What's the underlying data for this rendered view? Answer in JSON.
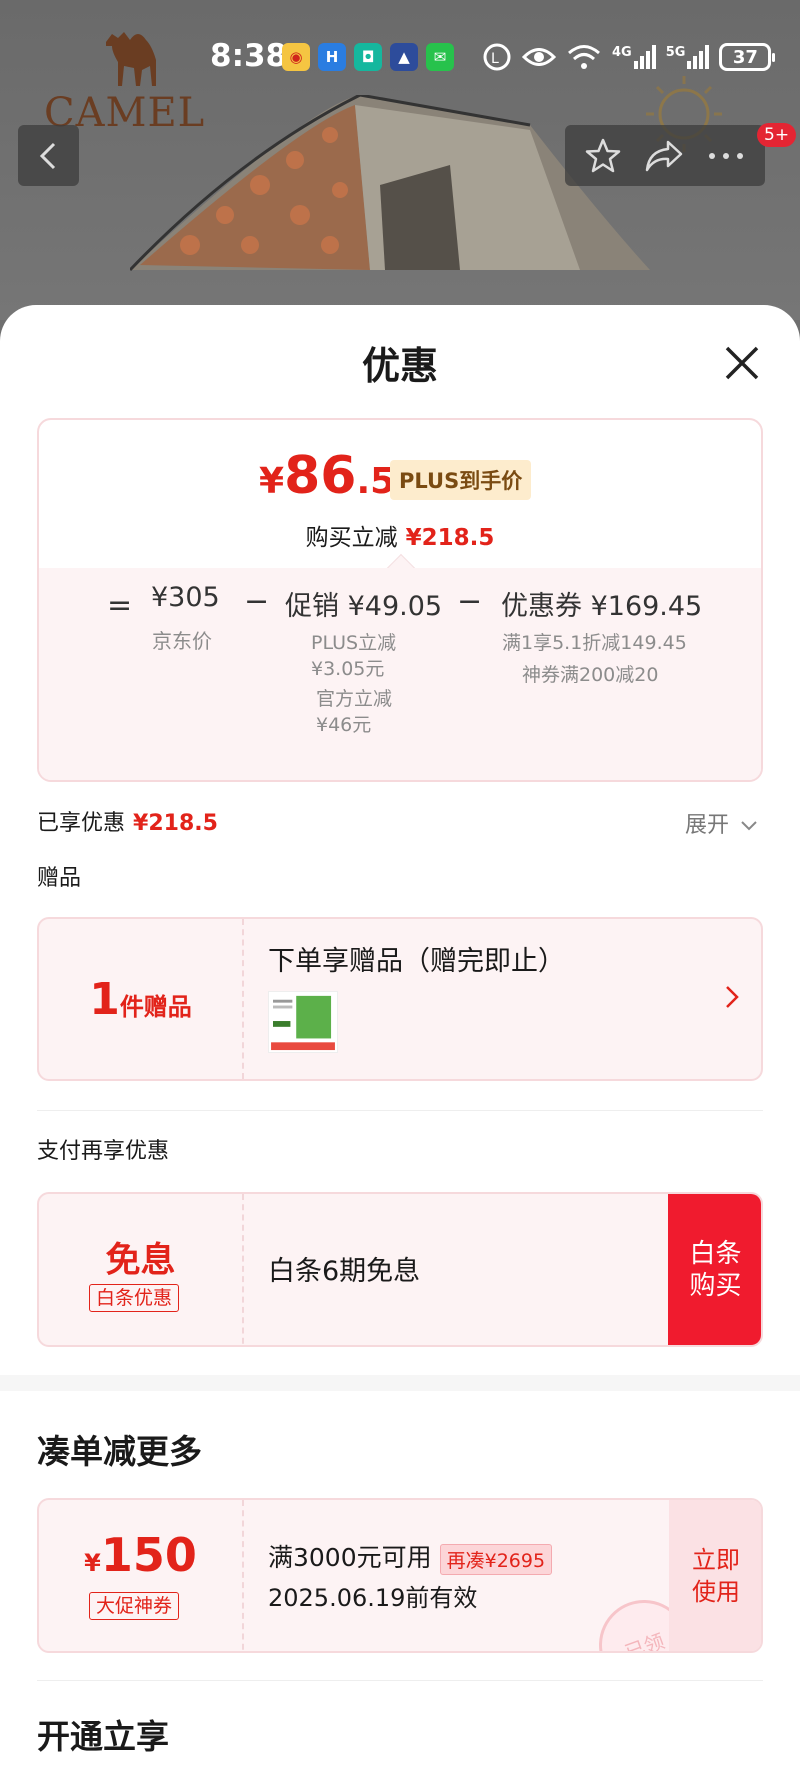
{
  "status_bar": {
    "time": "8:38",
    "network_4g": "4G",
    "network_5g": "5G",
    "battery": "37"
  },
  "background": {
    "brand": "CAMEL",
    "badge_count": "5+"
  },
  "sheet": {
    "title": "优惠",
    "price_card": {
      "final_price_yen": "¥",
      "final_price_int": "86",
      "final_price_dec": ".5",
      "plus_tag": "PLUS到手价",
      "reduce_label": "购买立减",
      "reduce_amount": "¥218.5",
      "eq": "=",
      "minus1": "−",
      "minus2": "−",
      "jd_price": "¥305",
      "jd_label": "京东价",
      "promo_amount": "促销 ¥49.05",
      "promo_sub1": "PLUS立减",
      "promo_sub1_val": "¥3.05元",
      "promo_sub2": "官方立减",
      "promo_sub2_val": "¥46元",
      "coupon_amount": "优惠券 ¥169.45",
      "coupon_sub1": "满1享5.1折减149.45",
      "coupon_sub2": "神券满200减20"
    },
    "enjoyed_label": "已享优惠",
    "enjoyed_amount": "¥218.5",
    "expand_label": "展开",
    "gift_heading": "赠品",
    "gift": {
      "count": "1",
      "count_label": "件赠品",
      "title": "下单享赠品（赠完即止）"
    },
    "pay_heading": "支付再享优惠",
    "pay": {
      "main": "免息",
      "tag": "白条优惠",
      "text": "白条6期免息",
      "button": "白条购买"
    },
    "more_heading": "凑单减更多",
    "coupon": {
      "yen": "¥",
      "value": "150",
      "tag": "大促神券",
      "condition": "满3000元可用",
      "more_tag": "再凑¥2695",
      "validity": "2025.06.19前有效",
      "button": "立即使用",
      "stamp": "已领"
    },
    "open_heading": "开通立享"
  },
  "colors": {
    "accent_red": "#e2231a",
    "button_red": "#f01b2e",
    "card_bg": "#fdf3f4",
    "plus_tag_bg": "#fdeccd"
  }
}
